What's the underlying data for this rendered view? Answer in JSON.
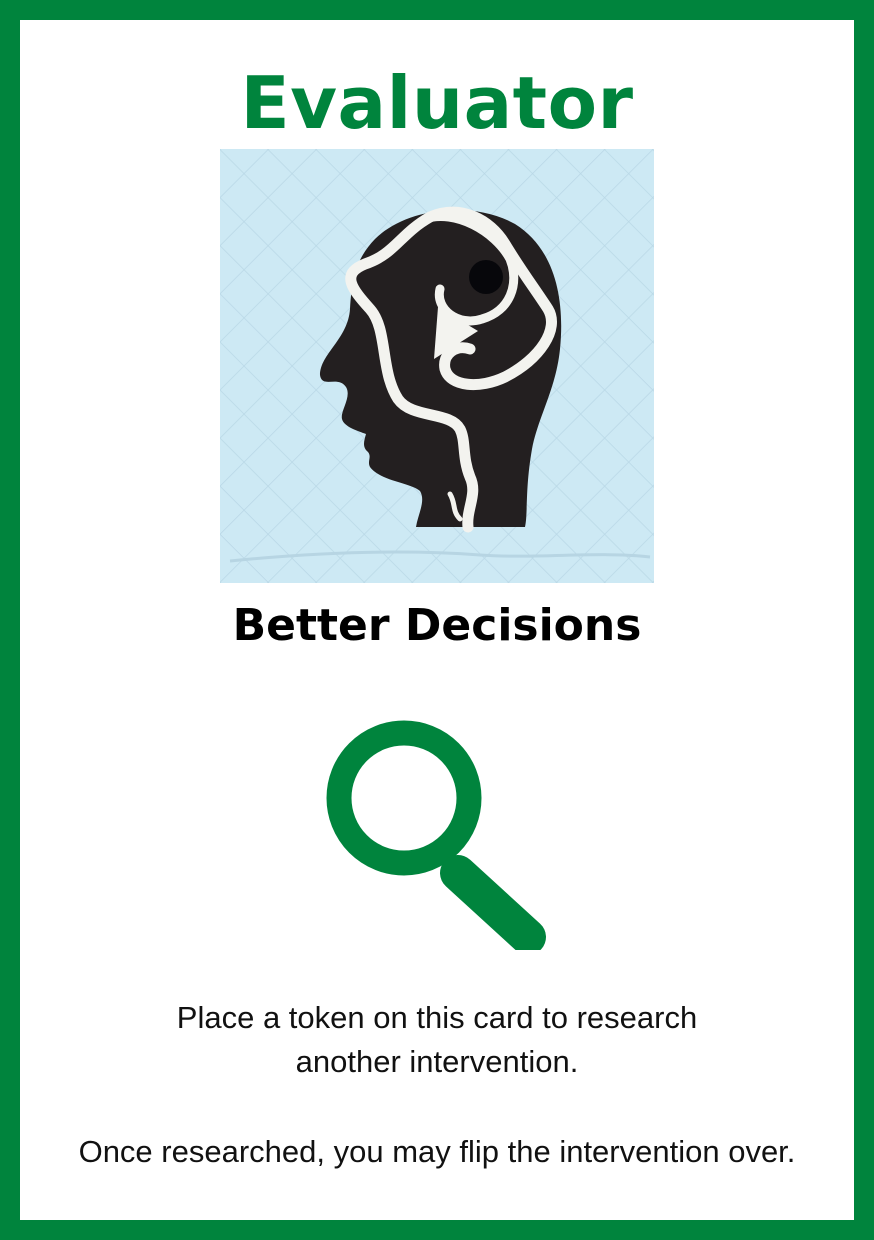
{
  "card": {
    "title": "Evaluator",
    "subtitle": "Better Decisions",
    "rule_text_1_line_1": "Place a token on this card to research",
    "rule_text_1_line_2": "another intervention.",
    "rule_text_2": "Once researched, you may flip the intervention over."
  },
  "colors": {
    "accent": "#00843d",
    "artwork_background": "#cde9f4",
    "head_silhouette": "#231f20"
  },
  "icons": {
    "artwork": "head-profile-illustration",
    "research": "magnifying-glass-icon"
  }
}
